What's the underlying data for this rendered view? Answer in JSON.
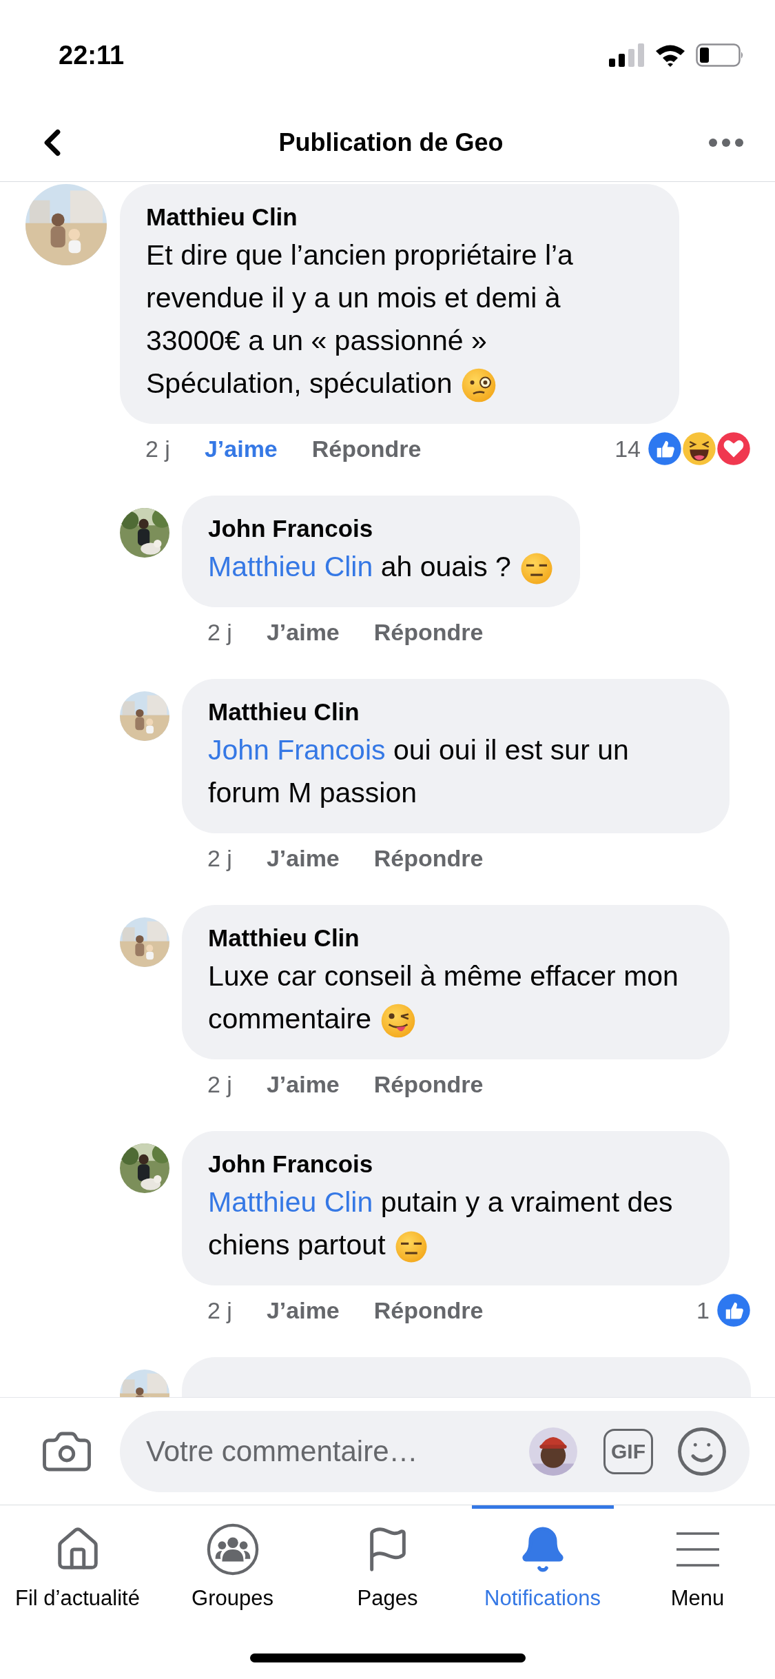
{
  "status_bar": {
    "time": "22:11"
  },
  "header": {
    "title": "Publication de Geo"
  },
  "comments": [
    {
      "kind": "comment",
      "author": "Matthieu Clin",
      "paragraphs": [
        "Et dire que l’ancien propriétaire l’a revendue il y a un mois et demi à 33000€ a un « passionné »",
        "Spéculation, spéculation"
      ],
      "emoji": {
        "kind": "monocle"
      },
      "time": "2 j",
      "like_label": "J’aime",
      "liked": true,
      "reply_label": "Répondre",
      "reaction_count": "14",
      "reactions": [
        {
          "kind": "like"
        },
        {
          "kind": "haha"
        },
        {
          "kind": "love"
        }
      ]
    },
    {
      "kind": "reply",
      "author": "John Francois",
      "mention": "Matthieu Clin",
      "paragraphs": [
        "ah ouais ?"
      ],
      "emoji": {
        "kind": "expressionless"
      },
      "time": "2 j",
      "like_label": "J’aime",
      "liked": false,
      "reply_label": "Répondre"
    },
    {
      "kind": "reply",
      "author": "Matthieu Clin",
      "mention": "John Francois",
      "paragraphs": [
        "oui oui il est sur un forum M passion"
      ],
      "time": "2 j",
      "like_label": "J’aime",
      "liked": false,
      "reply_label": "Répondre"
    },
    {
      "kind": "reply",
      "author": "Matthieu Clin",
      "paragraphs": [
        "Luxe car conseil à même effacer mon commentaire"
      ],
      "emoji": {
        "kind": "tongue"
      },
      "time": "2 j",
      "like_label": "J’aime",
      "liked": false,
      "reply_label": "Répondre"
    },
    {
      "kind": "reply",
      "author": "John Francois",
      "mention": "Matthieu Clin",
      "paragraphs": [
        "putain y a vraiment des chiens partout"
      ],
      "emoji": {
        "kind": "expressionless"
      },
      "time": "2 j",
      "like_label": "J’aime",
      "liked": false,
      "reply_label": "Répondre",
      "reaction_count": "1",
      "reactions": [
        {
          "kind": "like"
        }
      ]
    },
    {
      "kind": "partial"
    }
  ],
  "composer": {
    "placeholder": "Votre commentaire…",
    "gif_label": "GIF"
  },
  "tabs": [
    {
      "label": "Fil d’actualité",
      "selected": false
    },
    {
      "label": "Groupes",
      "selected": false
    },
    {
      "label": "Pages",
      "selected": false
    },
    {
      "label": "Notifications",
      "selected": true
    },
    {
      "label": "Menu",
      "selected": false
    }
  ]
}
